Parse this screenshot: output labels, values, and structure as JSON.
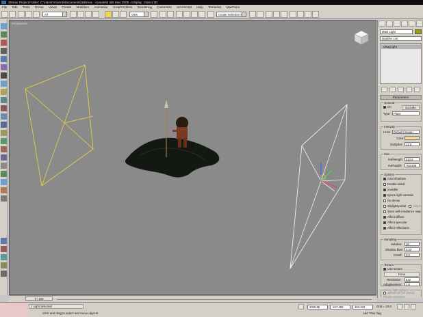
{
  "title_bar": {
    "text": "3Smax      Project Folder: C:\\Users\\Yvonne\\Documents\\3dsmax      - Autodesk 3ds Max  2009      - Display : Direct 3D"
  },
  "menu": [
    "File",
    "Edit",
    "Tools",
    "Group",
    "Views",
    "Create",
    "Modifiers",
    "Animation",
    "Graph Editors",
    "Rendering",
    "Customize",
    "MAXScript",
    "Help",
    "Tentacles",
    "MaxFarm"
  ],
  "toolbar": {
    "filter_dropdown": "All",
    "view_dropdown": "View",
    "named_selection_placeholder": "Create Selection Se"
  },
  "viewport": {
    "label": "Perspective"
  },
  "command_panel": {
    "object_name": "Main Light",
    "modifier_list": "Modifier List",
    "stack_item": "VRayLight",
    "rollout_title": "Parameters",
    "general": {
      "label": "General",
      "on_label": "On",
      "exclude_label": "Exclude",
      "type_label": "Type:",
      "type_value": "Plane"
    },
    "intensity": {
      "label": "Intensity",
      "units_label": "Units:",
      "units_value": "Default (image)",
      "color_label": "Color:",
      "multiplier_label": "Multiplier:",
      "multiplier_value": "12.0"
    },
    "size": {
      "label": "Size",
      "half_length_label": "Half-length:",
      "half_length_value": "810.0",
      "half_width_label": "Half-width:",
      "half_width_value": "763.908"
    },
    "options": {
      "label": "Options",
      "items": [
        {
          "label": "Cast shadows",
          "checked": true
        },
        {
          "label": "Double-sided",
          "checked": false
        },
        {
          "label": "Invisible",
          "checked": true
        },
        {
          "label": "Ignore light normals",
          "checked": true
        },
        {
          "label": "No decay",
          "checked": false
        },
        {
          "label": "Skylight portal",
          "checked": false
        },
        {
          "label": "Store with irradiance map",
          "checked": false
        },
        {
          "label": "Affect diffuse",
          "checked": true
        },
        {
          "label": "Affect specular",
          "checked": true
        },
        {
          "label": "Affect reflections",
          "checked": true
        }
      ],
      "simple_label": "Simple"
    },
    "sampling": {
      "label": "Sampling",
      "subdivs_label": "Subdivs:",
      "subdivs_value": "16",
      "shadow_bias_label": "Shadow bias:",
      "shadow_bias_value": "0.02",
      "cutoff_label": "Cutoff:",
      "cutoff_value": "0.0"
    },
    "texture": {
      "label": "Texture",
      "use_texture_label": "Use texture",
      "use_texture_checked": true,
      "none_button": "None",
      "resolution_label": "Resolution:",
      "resolution_value": "512",
      "adaptiveness_label": "Adaptiveness:",
      "adaptiveness_value": "1.0"
    },
    "dome": {
      "label": "Dome light options",
      "spherical_label": "Spherical (full dome)",
      "photon_label": "Photon emission"
    }
  },
  "timebar": {
    "frame_text": "0 / 100"
  },
  "status": {
    "selection": "1 Light Selected",
    "prompt": "Click and drag to select and move objects",
    "x_value": "2025.95",
    "y_value": "-217.285",
    "z_value": "453.333",
    "grid": "Grid = 10.0",
    "add_time_tag": "Add Time Tag"
  },
  "colors": {
    "viewport_bg": "#8a8a8a",
    "selected_light": "#e8d24a",
    "light": "#f0f0f0",
    "ui_gray": "#d4d0c8",
    "accent_yellow": "#f0d44a"
  }
}
